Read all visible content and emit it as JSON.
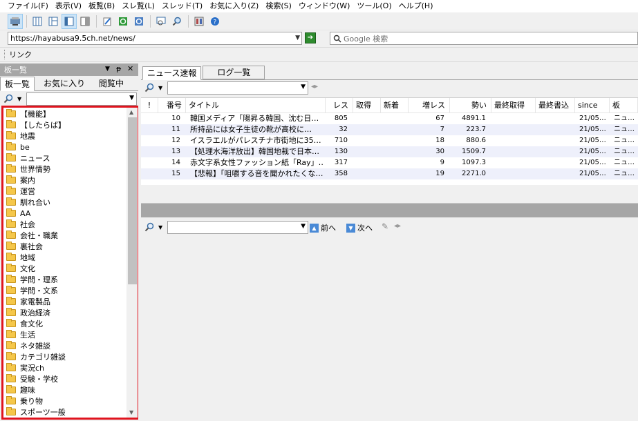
{
  "menu": [
    "ファイル(F)",
    "表示(V)",
    "板覧(B)",
    "スレ覧(L)",
    "スレッド(T)",
    "お気に入り(Z)",
    "検索(S)",
    "ウィンドウ(W)",
    "ツール(O)",
    "ヘルプ(H)"
  ],
  "address": {
    "url": "https://hayabusa9.5ch.net/news/",
    "search_placeholder": "Google 検索"
  },
  "link_bar": {
    "label": "リンク"
  },
  "left_panel": {
    "title": "板一覧",
    "tabs": [
      "板一覧",
      "お気に入り",
      "閲覧中"
    ],
    "items": [
      "【機能】",
      "【したらば】",
      "地震",
      "be",
      "ニュース",
      "世界情勢",
      "案内",
      "運営",
      "馴れ合い",
      "AA",
      "社会",
      "会社・職業",
      "裏社会",
      "地域",
      "文化",
      "学問・理系",
      "学問・文系",
      "家電製品",
      "政治経済",
      "食文化",
      "生活",
      "ネタ雑談",
      "カテゴリ雑談",
      "実況ch",
      "受験・学校",
      "趣味",
      "乗り物",
      "スポーツ一般"
    ]
  },
  "thread_tabs": [
    "ニュース速報",
    "ログ一覧"
  ],
  "columns": [
    "!",
    "番号",
    "タイトル",
    "レス",
    "取得",
    "新着",
    "増レス",
    "勢い",
    "最終取得",
    "最終書込",
    "since",
    "板"
  ],
  "rows": [
    {
      "no": "10",
      "title": "韓国メディア「陽昇る韓国、沈む日…",
      "res": "805",
      "get": "",
      "new": "",
      "inc": "67",
      "mom": "4891.1",
      "since": "21/05…",
      "board": "ニュ…"
    },
    {
      "no": "11",
      "title": "所持品には女子生徒の靴が高校に…",
      "res": "32",
      "get": "",
      "new": "",
      "inc": "7",
      "mom": "223.7",
      "since": "21/05…",
      "board": "ニュ…"
    },
    {
      "no": "12",
      "title": "イスラエルがパレスチナ市街地に35…",
      "res": "710",
      "get": "",
      "new": "",
      "inc": "18",
      "mom": "880.6",
      "since": "21/05…",
      "board": "ニュ…"
    },
    {
      "no": "13",
      "title": "【処理水海洋放出】韓国地裁で日本…",
      "res": "130",
      "get": "",
      "new": "",
      "inc": "30",
      "mom": "1509.7",
      "since": "21/05…",
      "board": "ニュ…"
    },
    {
      "no": "14",
      "title": "赤文字系女性ファッション紙「Ray」…",
      "res": "317",
      "get": "",
      "new": "",
      "inc": "9",
      "mom": "1097.3",
      "since": "21/05…",
      "board": "ニュ…"
    },
    {
      "no": "15",
      "title": "【悲報】「咀嚼する音を聞かれたくな…",
      "res": "358",
      "get": "",
      "new": "",
      "inc": "19",
      "mom": "2271.0",
      "since": "21/05…",
      "board": "ニュ…"
    }
  ],
  "nav": {
    "prev": "前へ",
    "next": "次へ"
  },
  "colors": {
    "highlight_border": "#e0141e",
    "alt_row": "#eef0fb",
    "panel_header": "#a6a6a6"
  }
}
